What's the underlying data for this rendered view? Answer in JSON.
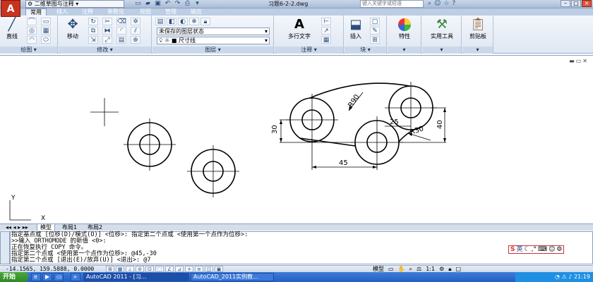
{
  "app": {
    "logo": "A",
    "workspace": "二维草图与注释",
    "doc_title": "习题6-2-2.dwg",
    "search_placeholder": "键入关键字或短语"
  },
  "ribbon_tabs": [
    "常用",
    "插入",
    "注释",
    "参数化",
    "视图",
    "管理",
    "输出"
  ],
  "ribbon": {
    "draw": {
      "title": "绘图",
      "line_label": "直线"
    },
    "modify": {
      "title": "修改",
      "move_label": "移动"
    },
    "layers": {
      "title": "图层",
      "state": "未保存的图层状态",
      "layer": "尺寸线"
    },
    "annotation": {
      "title": "注释",
      "mtext_label": "多行文字"
    },
    "block": {
      "title": "块",
      "insert_label": "插入"
    },
    "properties_label": "特性",
    "utilities_label": "实用工具",
    "clipboard_label": "剪贴板"
  },
  "drawing": {
    "dims": {
      "r90": "R90",
      "d25": "25",
      "r30": "R30",
      "d30": "30",
      "d40": "40",
      "d45": "45"
    },
    "ucs": {
      "x": "X",
      "y": "Y"
    }
  },
  "layout_tabs": [
    "模型",
    "布局1",
    "布局2"
  ],
  "command_lines": [
    "指定基点或 [位移(D)/模式(O)] <位移>: 指定第二个点或 <使用第一个点作为位移>:",
    ">>输入 ORTHOMODE 的新值 <0>:",
    "正在恢复执行 COPY 命令。",
    "指定第二个点或 <使用第一个点作为位移>: @45,-30",
    "指定第二个点或 [退出(E)/放弃(U)] <退出>: @7"
  ],
  "ime": {
    "brand": "S",
    "lang": "英"
  },
  "statusbar": {
    "coords": "-14.1565, 159.5888, 0.0000",
    "model": "模型",
    "scale": "1:1"
  },
  "taskbar": {
    "start": "开始",
    "tasks": [
      "AutoCAD 2011 - [习...",
      "AutoCAD_2011实例教..."
    ],
    "clock": "21:19"
  },
  "colors": {
    "ribbon_bg": "#dfe7f2",
    "taskbar": "#245fc4",
    "logo": "#c8321e"
  }
}
